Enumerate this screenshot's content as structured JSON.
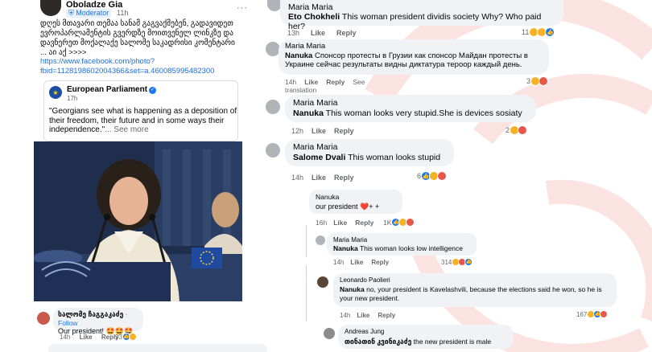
{
  "post": {
    "author": "Oboladze Gia",
    "moderator_badge": "Moderator",
    "time": "11h",
    "more": "···",
    "body": "დღეს მთავარი თემაა სანამ გაგვაქმებენ, გადავიდეთ ევროპარლამენტის გვერდზე მოითვენელ ლინკზე და დავნერეთ მოქალაქე სალომე საკადრისი კომენტარი ... აი აქ >>>>",
    "link": "https://www.facebook.com/photo?fbid=1128198602004366&set=a.460085995482300",
    "shared": {
      "page_name": "European Parliament",
      "time": "17h",
      "quote": "\"Georgians see what is happening as a deposition of their freedom, their future and in some ways their independence.\"",
      "see_more": "... See more"
    }
  },
  "photo_comment": {
    "author": "სალომე ჩაგგაკაძე",
    "follow": "· Follow",
    "text": "Our president! 🤩🤩🤩",
    "time": "14h",
    "like": "Like",
    "reply": "Reply",
    "count": "93"
  },
  "comments": [
    {
      "author": "Maria Maria",
      "mention": "Eto Chokheli",
      "text": "This woman president dividis society Why? Who paid her?",
      "time": "13h",
      "like": "Like",
      "reply": "Reply",
      "count": "11"
    },
    {
      "author": "Maria Maria",
      "mention": "Nanuka",
      "text": "Спонсор протесты в Грузии как спонсор Майдан протесты в Украине сейчас результаты видны диктатура тероор каждый день.",
      "time": "14h",
      "like": "Like",
      "reply": "Reply",
      "see_translation": "See translation",
      "count": "3"
    },
    {
      "author": "Maria Maria",
      "mention": "Nanuka",
      "text": "This woman looks very stupid.She is devices sosiaty",
      "time": "12h",
      "like": "Like",
      "reply": "Reply",
      "count": "2"
    },
    {
      "author": "Maria Maria",
      "mention": "Salome Dvali",
      "text": "This woman looks stupid",
      "time": "14h",
      "like": "Like",
      "reply": "Reply",
      "count": "6"
    },
    {
      "author": "Nanuka",
      "mention": "",
      "text": "our president ❤️+ +",
      "time": "16h",
      "like": "Like",
      "reply": "Reply",
      "count": "1K"
    },
    {
      "author": "Maria Maria",
      "mention": "Nanuka",
      "text": "This woman looks low intelligence",
      "time": "14h",
      "like": "Like",
      "reply": "Reply",
      "count": "314"
    },
    {
      "author": "Leonardo Paolieri",
      "mention": "Nanuka",
      "text": "no, your president is Kavelashvili, because the elections said he won, so he is your new president.",
      "time": "14h",
      "like": "Like",
      "reply": "Reply",
      "count": "167"
    },
    {
      "author": "Andreas Jung",
      "mention": "თინათინ კვინიკაძე",
      "text": "the new president is male",
      "time": "",
      "like": "",
      "reply": "",
      "count": ""
    }
  ],
  "icons": {
    "like": "like-icon",
    "haha": "haha-icon",
    "angry": "angry-icon",
    "verified": "verified-icon"
  },
  "colors": {
    "link": "#216fdb",
    "bubble": "#f0f2f5",
    "like_blue": "#1877f2",
    "accent_red": "#e8574b"
  }
}
